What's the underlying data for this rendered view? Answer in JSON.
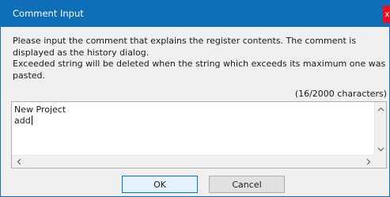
{
  "dialog": {
    "title": "Comment Input",
    "close_glyph": "x",
    "description": [
      "Please input the comment that explains the register contents. The comment is",
      "displayed as the history dialog.",
      "Exceeded string will be deleted when the string which exceeds its maximum one was",
      "pasted."
    ],
    "char_count": "(16/2000 characters)",
    "editor_lines": [
      "New Project",
      "add"
    ],
    "ok_label": "OK",
    "cancel_label": "Cancel"
  },
  "colors": {
    "titlebar": "#0e6fb8",
    "close": "#e81123",
    "default_button_border": "#0078d7"
  },
  "icons": {
    "close": "close-icon",
    "scroll_up": "chevron-up-icon",
    "scroll_down": "chevron-down-icon",
    "scroll_left": "chevron-left-icon",
    "scroll_right": "chevron-right-icon"
  }
}
